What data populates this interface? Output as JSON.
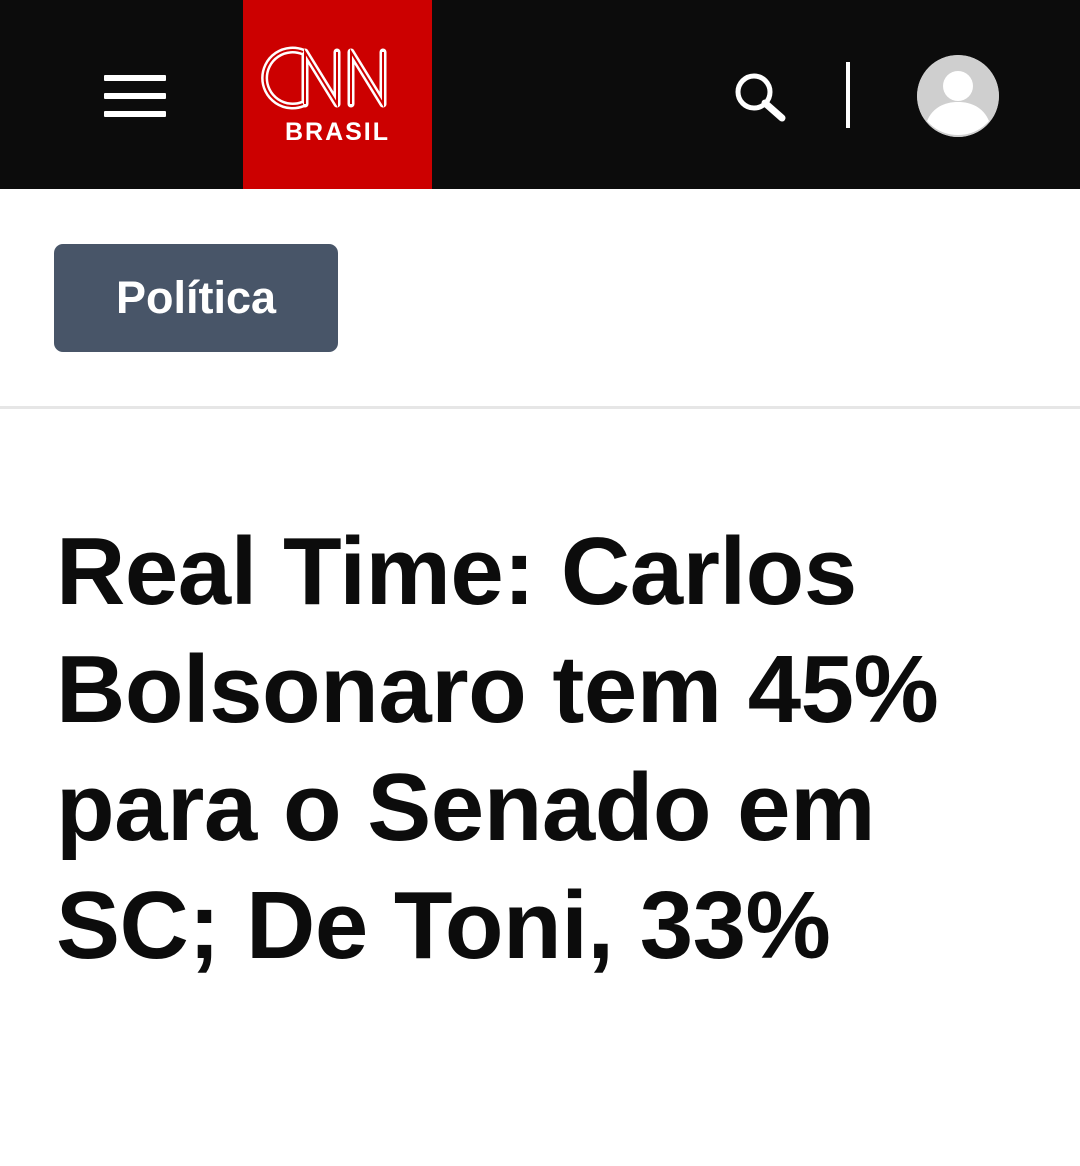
{
  "header": {
    "background_color": "#0c0c0c",
    "menu_icon": "hamburger-menu-icon",
    "logo": {
      "brand": "CNN",
      "subtitle": "BRASIL",
      "color": "#cc0000"
    },
    "search_icon": "search-icon",
    "account_icon": "user-avatar-icon"
  },
  "article": {
    "category": "Política",
    "category_color": "#485568",
    "headline": "Real Time: Carlos Bolsonaro tem 45% para o Senado em SC; De Toni, 33%"
  }
}
